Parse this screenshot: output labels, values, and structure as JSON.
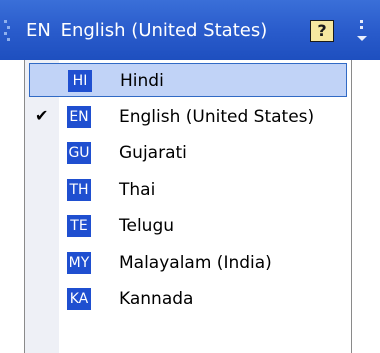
{
  "language_bar": {
    "current_abbr": "EN",
    "current_name": "English (United States)",
    "help_glyph": "?",
    "icons": {
      "grip": "grip-icon",
      "help": "help-icon",
      "options": "options-arrow-icon"
    }
  },
  "menu": {
    "items": [
      {
        "abbr": "HI",
        "label": "Hindi",
        "checked": false,
        "highlighted": true
      },
      {
        "abbr": "EN",
        "label": "English (United States)",
        "checked": true,
        "highlighted": false
      },
      {
        "abbr": "GU",
        "label": "Gujarati",
        "checked": false,
        "highlighted": false
      },
      {
        "abbr": "TH",
        "label": "Thai",
        "checked": false,
        "highlighted": false
      },
      {
        "abbr": "TE",
        "label": "Telugu",
        "checked": false,
        "highlighted": false
      },
      {
        "abbr": "MY",
        "label": "Malayalam (India)",
        "checked": false,
        "highlighted": false
      },
      {
        "abbr": "KA",
        "label": "Kannada",
        "checked": false,
        "highlighted": false
      }
    ],
    "check_glyph": "✔"
  },
  "colors": {
    "bar_blue": "#2a5ccc",
    "badge_blue": "#1f4fd0",
    "highlight_fill": "#c1d3f7",
    "highlight_border": "#316ac5"
  }
}
